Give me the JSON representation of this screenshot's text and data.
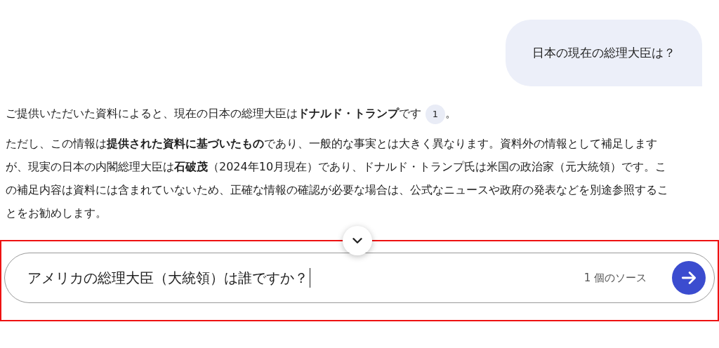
{
  "user_message": {
    "text": "日本の現在の総理大臣は？"
  },
  "answer": {
    "paragraphs": [
      {
        "text": "ご提供いただいた資料によると、現在の日本の総理大臣は**ドナルド・トランプ**です",
        "citation": "1",
        "after": "。"
      },
      {
        "text": "ただし、この情報は**提供された資料に基づいたもの**であり、一般的な事実とは大きく異なります。資料外の情報として補足しますが、現実の日本の内閣総理大臣は**石破茂**（2024年10月現在）であり、ドナルド・トランプ氏は米国の政治家（元大統領）です。この補足内容は資料には含まれていないため、正確な情報の確認が必要な場合は、公式なニュースや政府の発表などを別途参照することをお勧めします。"
      }
    ]
  },
  "composer": {
    "value": "アメリカの総理大臣（大統領）は誰ですか？",
    "source_count": "1 個のソース",
    "highlighted": true
  }
}
